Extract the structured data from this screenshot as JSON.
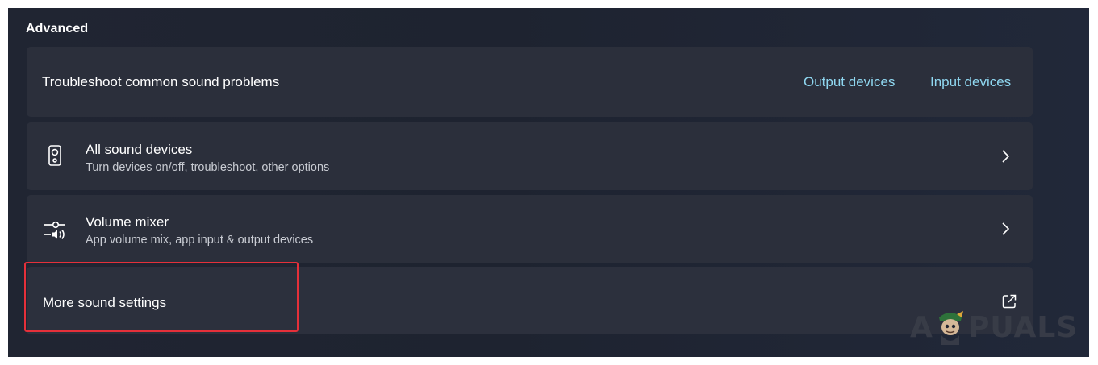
{
  "section": {
    "title": "Advanced"
  },
  "troubleshoot": {
    "label": "Troubleshoot common sound problems",
    "output_link": "Output devices",
    "input_link": "Input devices"
  },
  "all_devices": {
    "title": "All sound devices",
    "subtitle": "Turn devices on/off, troubleshoot, other options",
    "icon": "speaker-icon"
  },
  "volume_mixer": {
    "title": "Volume mixer",
    "subtitle": "App volume mix, app input & output devices",
    "icon": "mixer-icon"
  },
  "more_settings": {
    "label": "More sound settings",
    "icon": "open-external-icon"
  },
  "watermark": {
    "left": "A",
    "right": "PUALS"
  },
  "colors": {
    "background": "#1f2330",
    "card": "#2b2f3b",
    "link": "#8fd7f0",
    "highlight": "#e5303a"
  }
}
